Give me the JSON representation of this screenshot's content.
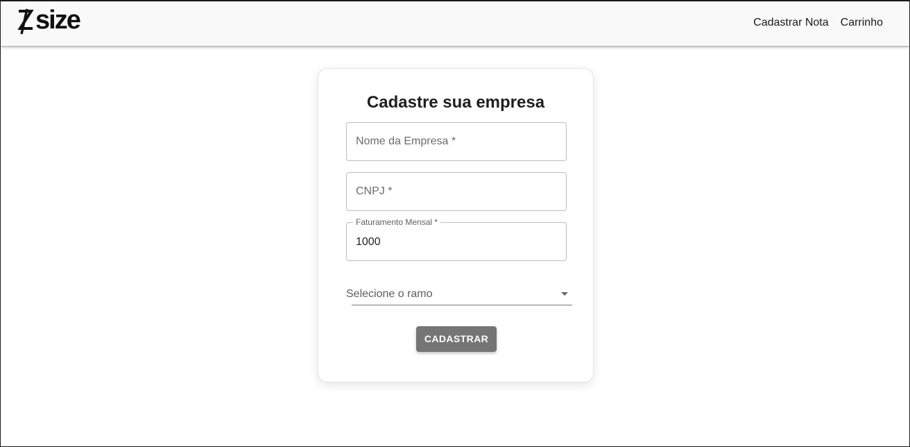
{
  "header": {
    "logo_text": "size",
    "nav": [
      {
        "label": "Cadastrar Nota"
      },
      {
        "label": "Carrinho"
      }
    ]
  },
  "form": {
    "title": "Cadastre sua empresa",
    "company_name": {
      "placeholder": "Nome da Empresa *",
      "value": ""
    },
    "cnpj": {
      "placeholder": "CNPJ *",
      "value": ""
    },
    "revenue": {
      "label": "Faturamento Mensal *",
      "value": "1000"
    },
    "sector": {
      "placeholder": "Selecione o ramo",
      "value": ""
    },
    "submit_label": "CADASTRAR"
  },
  "colors": {
    "header_bg": "#f9f9f9",
    "button_bg": "#757575",
    "text": "#1f1f1f",
    "border": "#bdbdbd"
  },
  "icons": {
    "logo_mark": "z-slash-logo-icon",
    "select_arrow": "dropdown-arrow-icon"
  }
}
